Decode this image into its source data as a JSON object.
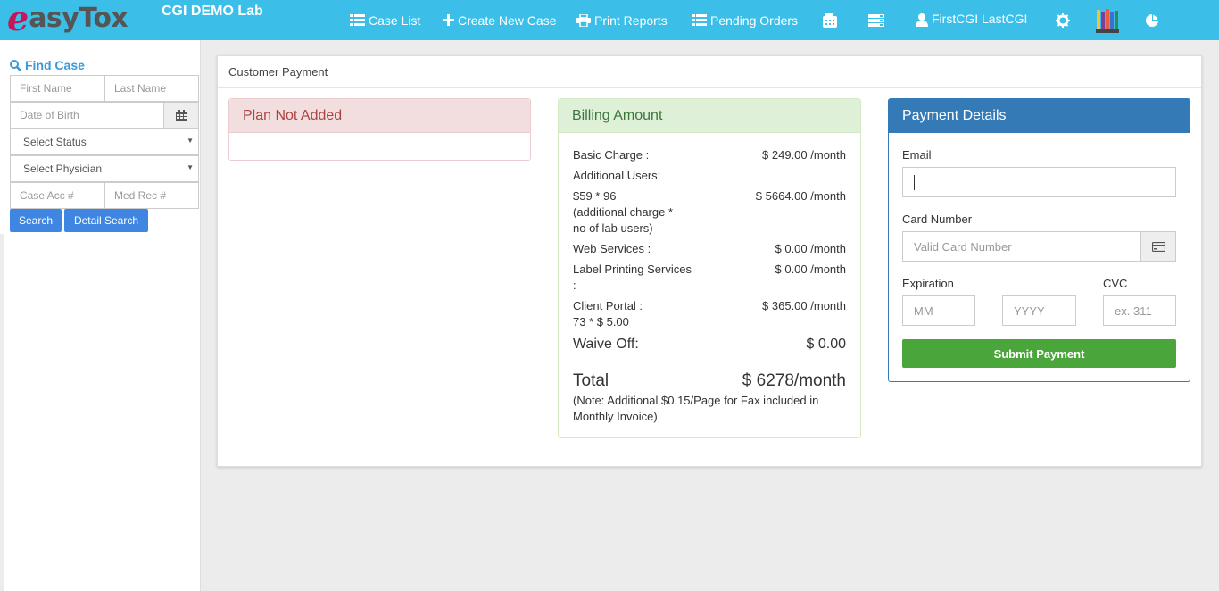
{
  "app": {
    "logo_part1": "e",
    "logo_part2": "asyTox",
    "lab_name": "CGI DEMO Lab"
  },
  "nav": {
    "case_list": "Case List",
    "create_new_case": "Create New Case",
    "print_reports": "Print Reports",
    "pending_orders": "Pending Orders",
    "user_name": "FirstCGI LastCGI",
    "icons": [
      "fax-icon",
      "server-icon",
      "user-icon",
      "gear-icon",
      "books-icon",
      "pie-chart-icon"
    ]
  },
  "sidebar": {
    "find_case": "Find Case",
    "first_name_placeholder": "First Name",
    "last_name_placeholder": "Last Name",
    "dob_placeholder": "Date of Birth",
    "status_select": "Select Status",
    "physician_select": "Select Physician",
    "case_acc_placeholder": "Case Acc #",
    "med_rec_placeholder": "Med Rec #",
    "search_btn": "Search",
    "detail_search_btn": "Detail Search"
  },
  "main": {
    "title": "Customer Payment",
    "plan": {
      "heading": "Plan Not Added"
    },
    "billing": {
      "heading": "Billing Amount",
      "basic_charge_label": "Basic Charge :",
      "basic_charge_value": "$ 249.00 /month",
      "additional_users_label": "Additional Users:",
      "users_calc_line1": "$59 * 96",
      "users_calc_line2": "(additional charge *",
      "users_calc_line3": "no of lab users)",
      "users_value": "$ 5664.00 /month",
      "web_services_label": "Web Services :",
      "web_services_value": "$ 0.00 /month",
      "label_printing_line1": "Label Printing Services",
      "label_printing_line2": ":",
      "label_printing_value": "$ 0.00 /month",
      "client_portal_line1": "Client Portal :",
      "client_portal_line2": "73 * $ 5.00",
      "client_portal_value": "$ 365.00 /month",
      "waive_off_label": "Waive Off:",
      "waive_off_value": "$ 0.00",
      "total_label": "Total",
      "total_value": "$ 6278/month",
      "note_line1": "(Note: Additional $0.15/Page for Fax included in",
      "note_line2": "Monthly Invoice)"
    },
    "payment": {
      "heading": "Payment Details",
      "email_label": "Email",
      "email_value": "",
      "card_label": "Card Number",
      "card_placeholder": "Valid Card Number",
      "expiration_label": "Expiration",
      "cvc_label": "CVC",
      "mm_placeholder": "MM",
      "yyyy_placeholder": "YYYY",
      "cvc_placeholder": "ex. 311",
      "submit": "Submit Payment"
    }
  },
  "colors": {
    "topbar": "#3bbfe9",
    "link_blue": "#3a9ad9",
    "button_blue": "#3f86e3",
    "danger_bg": "#f2dede",
    "success_bg": "#dff0d8",
    "primary": "#337ab7",
    "submit_green": "#4aa53a"
  }
}
